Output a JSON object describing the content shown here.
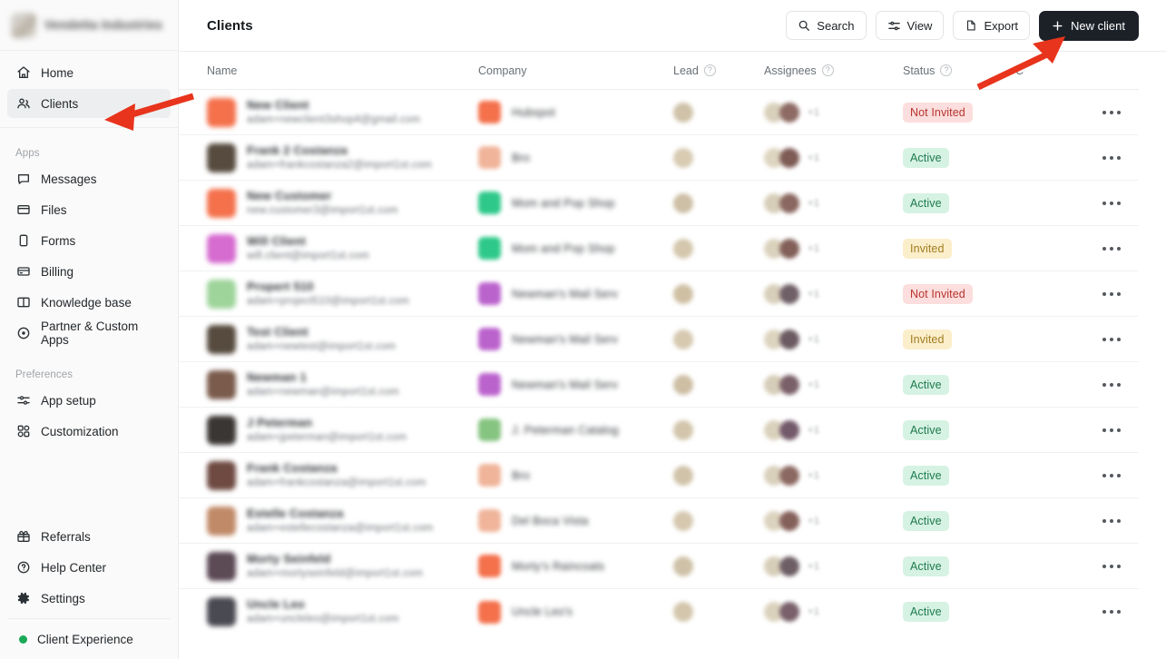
{
  "workspace": {
    "name": "Vendetta Industries",
    "logo_icon": "workspace-logo"
  },
  "sidebar": {
    "primary": [
      {
        "label": "Home",
        "icon": "home-icon",
        "active": false
      },
      {
        "label": "Clients",
        "icon": "clients-icon",
        "active": true
      }
    ],
    "groups": [
      {
        "label": "Apps",
        "items": [
          {
            "label": "Messages",
            "icon": "message-icon"
          },
          {
            "label": "Files",
            "icon": "folder-icon"
          },
          {
            "label": "Forms",
            "icon": "clipboard-icon"
          },
          {
            "label": "Billing",
            "icon": "card-icon"
          },
          {
            "label": "Knowledge base",
            "icon": "book-icon"
          },
          {
            "label": "Partner & Custom Apps",
            "icon": "target-icon"
          }
        ]
      },
      {
        "label": "Preferences",
        "items": [
          {
            "label": "App setup",
            "icon": "sliders-icon"
          },
          {
            "label": "Customization",
            "icon": "grid-icon"
          }
        ]
      }
    ],
    "bottom": [
      {
        "label": "Referrals",
        "icon": "gift-icon"
      },
      {
        "label": "Help Center",
        "icon": "question-circle-icon"
      },
      {
        "label": "Settings",
        "icon": "gear-icon"
      }
    ],
    "experience": {
      "label": "Client Experience",
      "status_color": "#18a957"
    }
  },
  "topbar": {
    "title": "Clients",
    "search_label": "Search",
    "view_label": "View",
    "export_label": "Export",
    "new_client_label": "New client"
  },
  "table": {
    "columns": [
      {
        "key": "name",
        "label": "Name",
        "info": false
      },
      {
        "key": "company",
        "label": "Company",
        "info": false
      },
      {
        "key": "lead",
        "label": "Lead",
        "info": true
      },
      {
        "key": "assignees",
        "label": "Assignees",
        "info": true
      },
      {
        "key": "status",
        "label": "Status",
        "info": true
      },
      {
        "key": "extra",
        "label": "C",
        "info": false
      }
    ],
    "rows": [
      {
        "name": "New Client",
        "email": "adam+newclient3shop4@gmail.com",
        "avatar_color": "#f4714c",
        "company": "Hubspot",
        "company_color": "#f4714c",
        "status": "Not Invited",
        "status_kind": "notinvited",
        "assignee_extra": "+1"
      },
      {
        "name": "Frank 2 Costanza",
        "email": "adam+frankcostanza2@import1st.com",
        "avatar_color": "#574b3f",
        "company": "Bro",
        "company_color": "#f0b49a",
        "status": "Active",
        "status_kind": "active",
        "assignee_extra": "+1"
      },
      {
        "name": "New Customer",
        "email": "new.customer3@import1st.com",
        "avatar_color": "#f4714c",
        "company": "Mom and Pop Shop",
        "company_color": "#2ec98a",
        "status": "Active",
        "status_kind": "active",
        "assignee_extra": "+1"
      },
      {
        "name": "Will Client",
        "email": "will.client@import1st.com",
        "avatar_color": "#d66bd0",
        "company": "Mom and Pop Shop",
        "company_color": "#2ec98a",
        "status": "Invited",
        "status_kind": "invited",
        "assignee_extra": "+1"
      },
      {
        "name": "Propert 510",
        "email": "adam+project510@import1st.com",
        "avatar_color": "#9ed49a",
        "company": "Newman's Mail Serv",
        "company_color": "#bb63cd",
        "status": "Not Invited",
        "status_kind": "notinvited",
        "assignee_extra": "+1"
      },
      {
        "name": "Test Client",
        "email": "adam+newtest@import1st.com",
        "avatar_color": "#574b3f",
        "company": "Newman's Mail Serv",
        "company_color": "#bb63cd",
        "status": "Invited",
        "status_kind": "invited",
        "assignee_extra": "+1"
      },
      {
        "name": "Newman 1",
        "email": "adam+newman@import1st.com",
        "avatar_color": "#7a5b4c",
        "company": "Newman's Mail Serv",
        "company_color": "#bb63cd",
        "status": "Active",
        "status_kind": "active",
        "assignee_extra": "+1"
      },
      {
        "name": "J Peterman",
        "email": "adam+jpeterman@import1st.com",
        "avatar_color": "#3a3634",
        "company": "J. Peterman Catalog",
        "company_color": "#86c481",
        "status": "Active",
        "status_kind": "active",
        "assignee_extra": "+1"
      },
      {
        "name": "Frank Costanza",
        "email": "adam+frankcostanza@import1st.com",
        "avatar_color": "#6e4a42",
        "company": "Bro",
        "company_color": "#f0b49a",
        "status": "Active",
        "status_kind": "active",
        "assignee_extra": "+1"
      },
      {
        "name": "Estelle Costanza",
        "email": "adam+estellecostanza@import1st.com",
        "avatar_color": "#c08a68",
        "company": "Del Boca Vista",
        "company_color": "#f0b49a",
        "status": "Active",
        "status_kind": "active",
        "assignee_extra": "+1"
      },
      {
        "name": "Morty Seinfeld",
        "email": "adam+mortyseinfeld@import1st.com",
        "avatar_color": "#5c4a55",
        "company": "Morty's Raincoats",
        "company_color": "#f4714c",
        "status": "Active",
        "status_kind": "active",
        "assignee_extra": "+1"
      },
      {
        "name": "Uncle Leo",
        "email": "adam+uncleleo@import1st.com",
        "avatar_color": "#4a4a52",
        "company": "Uncle Leo's",
        "company_color": "#f4714c",
        "status": "Active",
        "status_kind": "active",
        "assignee_extra": "+1"
      }
    ],
    "row_menu_icon": "more-horizontal-icon"
  },
  "annotations": {
    "color": "#e8341c",
    "arrows": [
      {
        "name": "arrow-pointing-clients",
        "target": "Clients"
      },
      {
        "name": "arrow-pointing-new-client",
        "target": "New client"
      }
    ]
  }
}
